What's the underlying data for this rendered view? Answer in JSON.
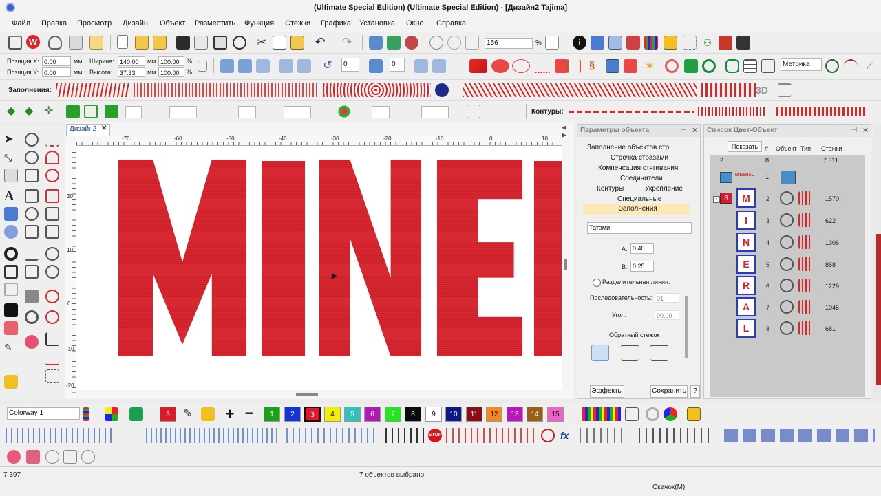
{
  "window": {
    "title": "(Ultimate Special Edition) (Ultimate Special Edition) - [Дизайн2       Tajima]"
  },
  "menu": [
    "Файл",
    "Правка",
    "Просмотр",
    "Дизайн",
    "Объект",
    "Разместить",
    "Функция",
    "Стежки",
    "Графика",
    "Установка",
    "Окно",
    "Справка"
  ],
  "toolbar": {
    "zoom": "156",
    "zoom_unit": "%",
    "units": "Метрика"
  },
  "position": {
    "x_label": "Позиция X:",
    "x_value": "0.00",
    "x_unit": "мм",
    "y_label": "Позиция Y:",
    "y_value": "0.00",
    "y_unit": "мм",
    "width_label": "Ширина:",
    "width_value": "140.00",
    "width_unit": "мм",
    "width_pct": "100.00",
    "width_pct_unit": "%",
    "height_label": "Высота:",
    "height_value": "37.33",
    "height_unit": "мм",
    "height_pct": "100.00",
    "height_pct_unit": "%",
    "rotate_value": "0",
    "slant_value": "0"
  },
  "fills_toolbar": {
    "label": "Заполнения:",
    "contours_label": "Контуры:"
  },
  "doc_tab": {
    "label": "Дизайн2",
    "close": "✕"
  },
  "ruler": {
    "h_ticks": [
      "-70",
      "-60",
      "-50",
      "-40",
      "-30",
      "-20",
      "-10",
      "0",
      "10"
    ],
    "v_ticks": [
      "20",
      "10",
      "0",
      "-10",
      "-20"
    ]
  },
  "design_text": "MINERAL",
  "object_params": {
    "title": "Параметры объекта",
    "nav": [
      "Заполнение объектов стр...",
      "Строчка стразами",
      "Компенсация стягивания",
      "Соединители",
      "Контуры",
      "Укрепление",
      "Специальные",
      "Заполнения"
    ],
    "fill_type": "Татами",
    "a_label": "A:",
    "a_value": "0.40",
    "b_label": "B:",
    "b_value": "0.25",
    "split_line_label": "Разделительная линия:",
    "sequence_label": "Последовательность:",
    "sequence_value": "01",
    "angle_label": "Угол:",
    "angle_value": "90.00",
    "reverse_label": "Обратный стежок",
    "effects_button": "Эффекты",
    "save_button": "Сохранить",
    "help_button": "?"
  },
  "color_object_list": {
    "title": "Список Цвет-Объект",
    "show_button": "Показать",
    "headers": [
      "#",
      "Объект",
      "Тип",
      "Стежки"
    ],
    "summary": {
      "color": "2",
      "num": "8",
      "stitches": "7 311"
    },
    "group_row": {
      "num": "1",
      "label": "MINERAL"
    },
    "color_badge": "3",
    "rows": [
      {
        "letter": "M",
        "num": "2",
        "stitches": "1570"
      },
      {
        "letter": "I",
        "num": "3",
        "stitches": "622"
      },
      {
        "letter": "N",
        "num": "4",
        "stitches": "1306"
      },
      {
        "letter": "E",
        "num": "5",
        "stitches": "858"
      },
      {
        "letter": "R",
        "num": "6",
        "stitches": "1229"
      },
      {
        "letter": "A",
        "num": "7",
        "stitches": "1045"
      },
      {
        "letter": "L",
        "num": "8",
        "stitches": "681"
      }
    ]
  },
  "palette": {
    "colorway": "Colorway 1",
    "current": "3",
    "swatches": [
      {
        "label": "1",
        "color": "#1aa31a"
      },
      {
        "label": "2",
        "color": "#1433d8"
      },
      {
        "label": "3",
        "color": "#e0182a"
      },
      {
        "label": "4",
        "color": "#f4f000"
      },
      {
        "label": "5",
        "color": "#33c0b8"
      },
      {
        "label": "6",
        "color": "#b01ab0"
      },
      {
        "label": "7",
        "color": "#22e622"
      },
      {
        "label": "8",
        "color": "#0a0a0a"
      },
      {
        "label": "9",
        "color": "#ffffff"
      },
      {
        "label": "10",
        "color": "#0b1a8a"
      },
      {
        "label": "11",
        "color": "#8a0e14"
      },
      {
        "label": "12",
        "color": "#f08a20"
      },
      {
        "label": "13",
        "color": "#c012c0"
      },
      {
        "label": "14",
        "color": "#9a6018"
      },
      {
        "label": "15",
        "color": "#f060c8"
      }
    ]
  },
  "status": {
    "left": "7 397",
    "center": "7 объектов выбрано",
    "bottom": "Скачок(М)"
  }
}
